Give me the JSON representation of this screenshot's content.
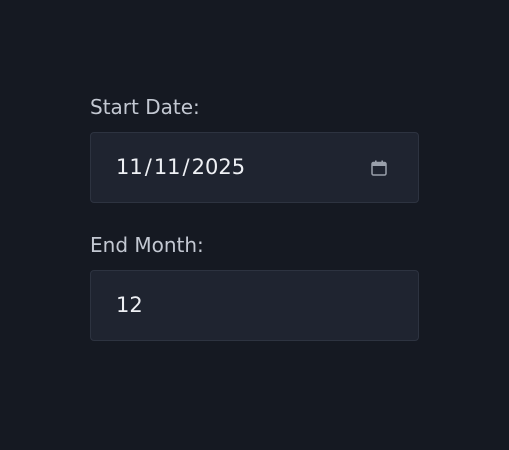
{
  "form": {
    "start_date": {
      "label": "Start Date:",
      "value": {
        "month": "11",
        "day": "11",
        "year": "2025",
        "separator": "/"
      },
      "icon": "calendar-icon"
    },
    "end_month": {
      "label": "End Month:",
      "value": "12"
    }
  },
  "colors": {
    "background": "#151922",
    "input_background": "#1f2430",
    "input_border": "#2d3340",
    "label_text": "#c3c8d2",
    "value_text": "#eef0f4",
    "icon": "#9aa0ab"
  }
}
